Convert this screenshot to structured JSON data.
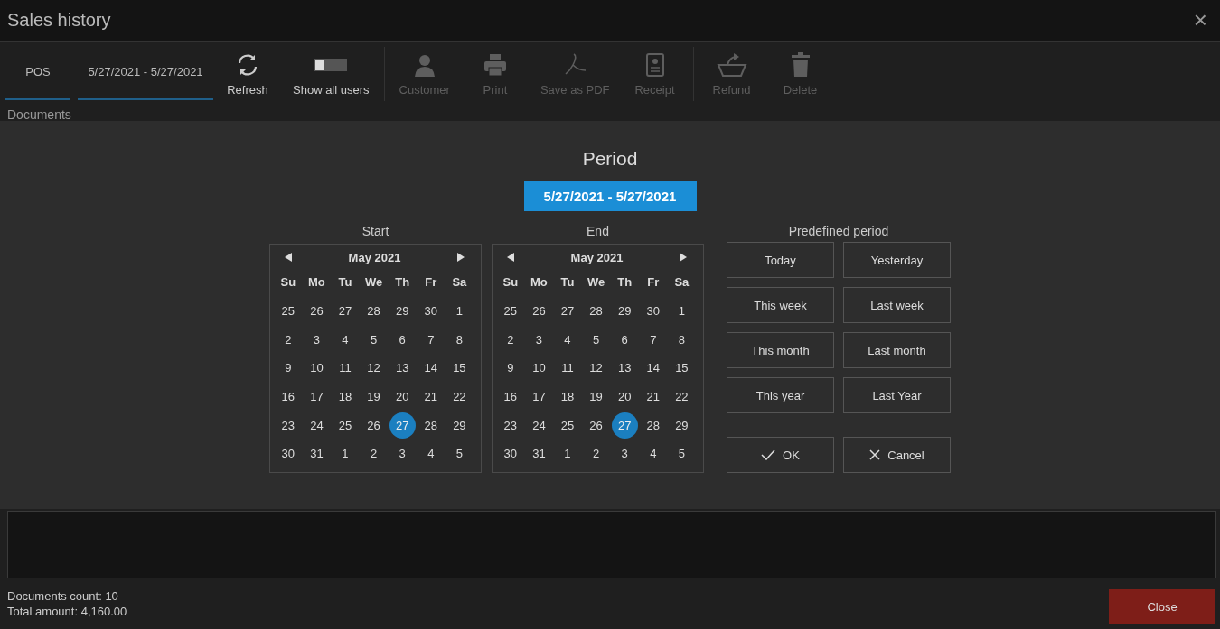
{
  "window": {
    "title": "Sales history",
    "close": "×"
  },
  "toolbar": {
    "tabs": [
      {
        "label": "POS",
        "selected": true
      },
      {
        "label": "5/27/2021 - 5/27/2021",
        "selected": true
      }
    ],
    "tools": [
      {
        "kind": "refresh",
        "label": "Refresh",
        "disabled": false
      },
      {
        "kind": "toggle",
        "label": "Show all users",
        "disabled": false
      },
      {
        "kind": "customer",
        "label": "Customer",
        "disabled": true
      },
      {
        "kind": "print",
        "label": "Print",
        "disabled": true
      },
      {
        "kind": "pdf",
        "label": "Save as PDF",
        "disabled": true
      },
      {
        "kind": "receipt",
        "label": "Receipt",
        "disabled": true
      },
      {
        "kind": "refund",
        "label": "Refund",
        "disabled": true
      },
      {
        "kind": "delete",
        "label": "Delete",
        "disabled": true
      }
    ]
  },
  "section_label": "Documents",
  "period_dialog": {
    "title": "Period",
    "range": "5/27/2021 - 5/27/2021",
    "calendars": [
      {
        "heading": "Start",
        "month": "May 2021",
        "weekdays": [
          "Su",
          "Mo",
          "Tu",
          "We",
          "Th",
          "Fr",
          "Sa"
        ],
        "weeks": [
          [
            {
              "d": "25",
              "selected": false
            },
            {
              "d": "26",
              "selected": false
            },
            {
              "d": "27",
              "selected": false
            },
            {
              "d": "28",
              "selected": false
            },
            {
              "d": "29",
              "selected": false
            },
            {
              "d": "30",
              "selected": false
            },
            {
              "d": "1",
              "selected": false
            }
          ],
          [
            {
              "d": "2",
              "selected": false
            },
            {
              "d": "3",
              "selected": false
            },
            {
              "d": "4",
              "selected": false
            },
            {
              "d": "5",
              "selected": false
            },
            {
              "d": "6",
              "selected": false
            },
            {
              "d": "7",
              "selected": false
            },
            {
              "d": "8",
              "selected": false
            }
          ],
          [
            {
              "d": "9",
              "selected": false
            },
            {
              "d": "10",
              "selected": false
            },
            {
              "d": "11",
              "selected": false
            },
            {
              "d": "12",
              "selected": false
            },
            {
              "d": "13",
              "selected": false
            },
            {
              "d": "14",
              "selected": false
            },
            {
              "d": "15",
              "selected": false
            }
          ],
          [
            {
              "d": "16",
              "selected": false
            },
            {
              "d": "17",
              "selected": false
            },
            {
              "d": "18",
              "selected": false
            },
            {
              "d": "19",
              "selected": false
            },
            {
              "d": "20",
              "selected": false
            },
            {
              "d": "21",
              "selected": false
            },
            {
              "d": "22",
              "selected": false
            }
          ],
          [
            {
              "d": "23",
              "selected": false
            },
            {
              "d": "24",
              "selected": false
            },
            {
              "d": "25",
              "selected": false
            },
            {
              "d": "26",
              "selected": false
            },
            {
              "d": "27",
              "selected": true
            },
            {
              "d": "28",
              "selected": false
            },
            {
              "d": "29",
              "selected": false
            }
          ],
          [
            {
              "d": "30",
              "selected": false
            },
            {
              "d": "31",
              "selected": false
            },
            {
              "d": "1",
              "selected": false
            },
            {
              "d": "2",
              "selected": false
            },
            {
              "d": "3",
              "selected": false
            },
            {
              "d": "4",
              "selected": false
            },
            {
              "d": "5",
              "selected": false
            }
          ]
        ]
      },
      {
        "heading": "End",
        "month": "May 2021",
        "weekdays": [
          "Su",
          "Mo",
          "Tu",
          "We",
          "Th",
          "Fr",
          "Sa"
        ],
        "weeks": [
          [
            {
              "d": "25",
              "selected": false
            },
            {
              "d": "26",
              "selected": false
            },
            {
              "d": "27",
              "selected": false
            },
            {
              "d": "28",
              "selected": false
            },
            {
              "d": "29",
              "selected": false
            },
            {
              "d": "30",
              "selected": false
            },
            {
              "d": "1",
              "selected": false
            }
          ],
          [
            {
              "d": "2",
              "selected": false
            },
            {
              "d": "3",
              "selected": false
            },
            {
              "d": "4",
              "selected": false
            },
            {
              "d": "5",
              "selected": false
            },
            {
              "d": "6",
              "selected": false
            },
            {
              "d": "7",
              "selected": false
            },
            {
              "d": "8",
              "selected": false
            }
          ],
          [
            {
              "d": "9",
              "selected": false
            },
            {
              "d": "10",
              "selected": false
            },
            {
              "d": "11",
              "selected": false
            },
            {
              "d": "12",
              "selected": false
            },
            {
              "d": "13",
              "selected": false
            },
            {
              "d": "14",
              "selected": false
            },
            {
              "d": "15",
              "selected": false
            }
          ],
          [
            {
              "d": "16",
              "selected": false
            },
            {
              "d": "17",
              "selected": false
            },
            {
              "d": "18",
              "selected": false
            },
            {
              "d": "19",
              "selected": false
            },
            {
              "d": "20",
              "selected": false
            },
            {
              "d": "21",
              "selected": false
            },
            {
              "d": "22",
              "selected": false
            }
          ],
          [
            {
              "d": "23",
              "selected": false
            },
            {
              "d": "24",
              "selected": false
            },
            {
              "d": "25",
              "selected": false
            },
            {
              "d": "26",
              "selected": false
            },
            {
              "d": "27",
              "selected": true
            },
            {
              "d": "28",
              "selected": false
            },
            {
              "d": "29",
              "selected": false
            }
          ],
          [
            {
              "d": "30",
              "selected": false
            },
            {
              "d": "31",
              "selected": false
            },
            {
              "d": "1",
              "selected": false
            },
            {
              "d": "2",
              "selected": false
            },
            {
              "d": "3",
              "selected": false
            },
            {
              "d": "4",
              "selected": false
            },
            {
              "d": "5",
              "selected": false
            }
          ]
        ]
      }
    ],
    "predefined_heading": "Predefined period",
    "predefined": [
      "Today",
      "Yesterday",
      "This week",
      "Last week",
      "This month",
      "Last month",
      "This year",
      "Last Year"
    ],
    "actions": [
      {
        "kind": "ok",
        "label": "OK"
      },
      {
        "kind": "cancel",
        "label": "Cancel"
      }
    ]
  },
  "footer": {
    "documents_count": "Documents count: 10",
    "total_amount": "Total amount: 4,160.00",
    "close_button": "Close"
  }
}
